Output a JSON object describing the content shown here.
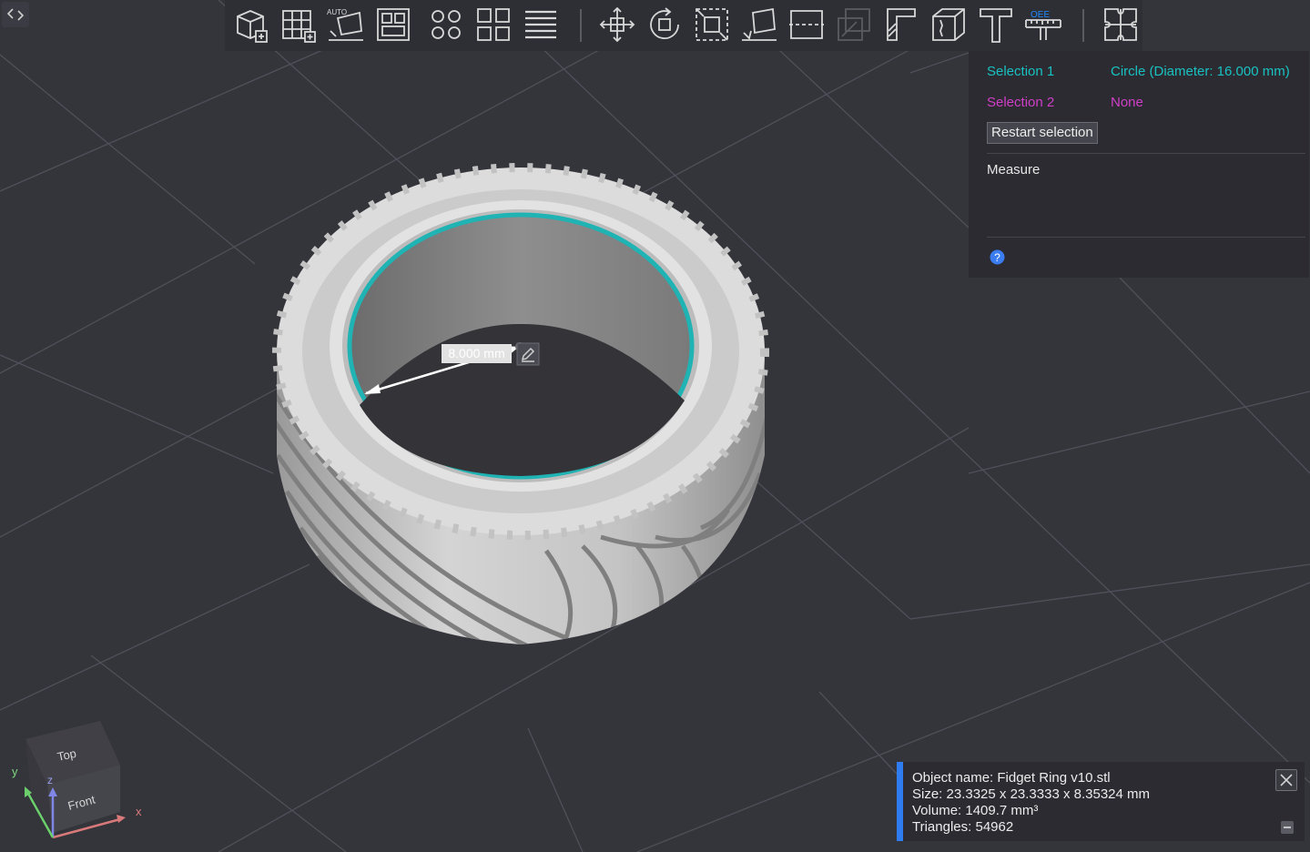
{
  "toolbar": {
    "icons": [
      "add-object-icon",
      "grid-add-icon",
      "auto-orient-icon",
      "arrange-icon",
      "split-objects-icon",
      "split-parts-icon",
      "layers-icon",
      "move-icon",
      "rotate-icon",
      "scale-icon",
      "place-on-face-icon",
      "cut-icon",
      "support-paint-icon",
      "seam-paint-icon",
      "fuzzy-skin-icon",
      "text-icon",
      "measure-icon",
      "assembly-icon"
    ],
    "measure_label": "OEE",
    "accent_color": "#1f8bff"
  },
  "measure_panel": {
    "selection1_label": "Selection 1",
    "selection1_value": "Circle (Diameter: 16.000 mm)",
    "selection2_label": "Selection 2",
    "selection2_value": "None",
    "restart_button": "Restart selection",
    "section_title": "Measure",
    "help_icon": "question-icon",
    "selection1_color": "#19c2c2",
    "selection2_color": "#d13fc9"
  },
  "viewport": {
    "dimension_label": "8.000 mm",
    "highlight_color": "#19b8b8"
  },
  "nav_cube": {
    "top_face": "Top",
    "front_face": "Front",
    "axis_x": "x",
    "axis_y": "y",
    "axis_z": "z"
  },
  "info_card": {
    "object_name": "Object name: Fidget Ring v10.stl",
    "size": "Size: 23.3325 x 23.3333 x 8.35324 mm",
    "volume": "Volume: 1409.7 mm³",
    "triangles": "Triangles: 54962",
    "accent_color": "#2f7bf0"
  }
}
